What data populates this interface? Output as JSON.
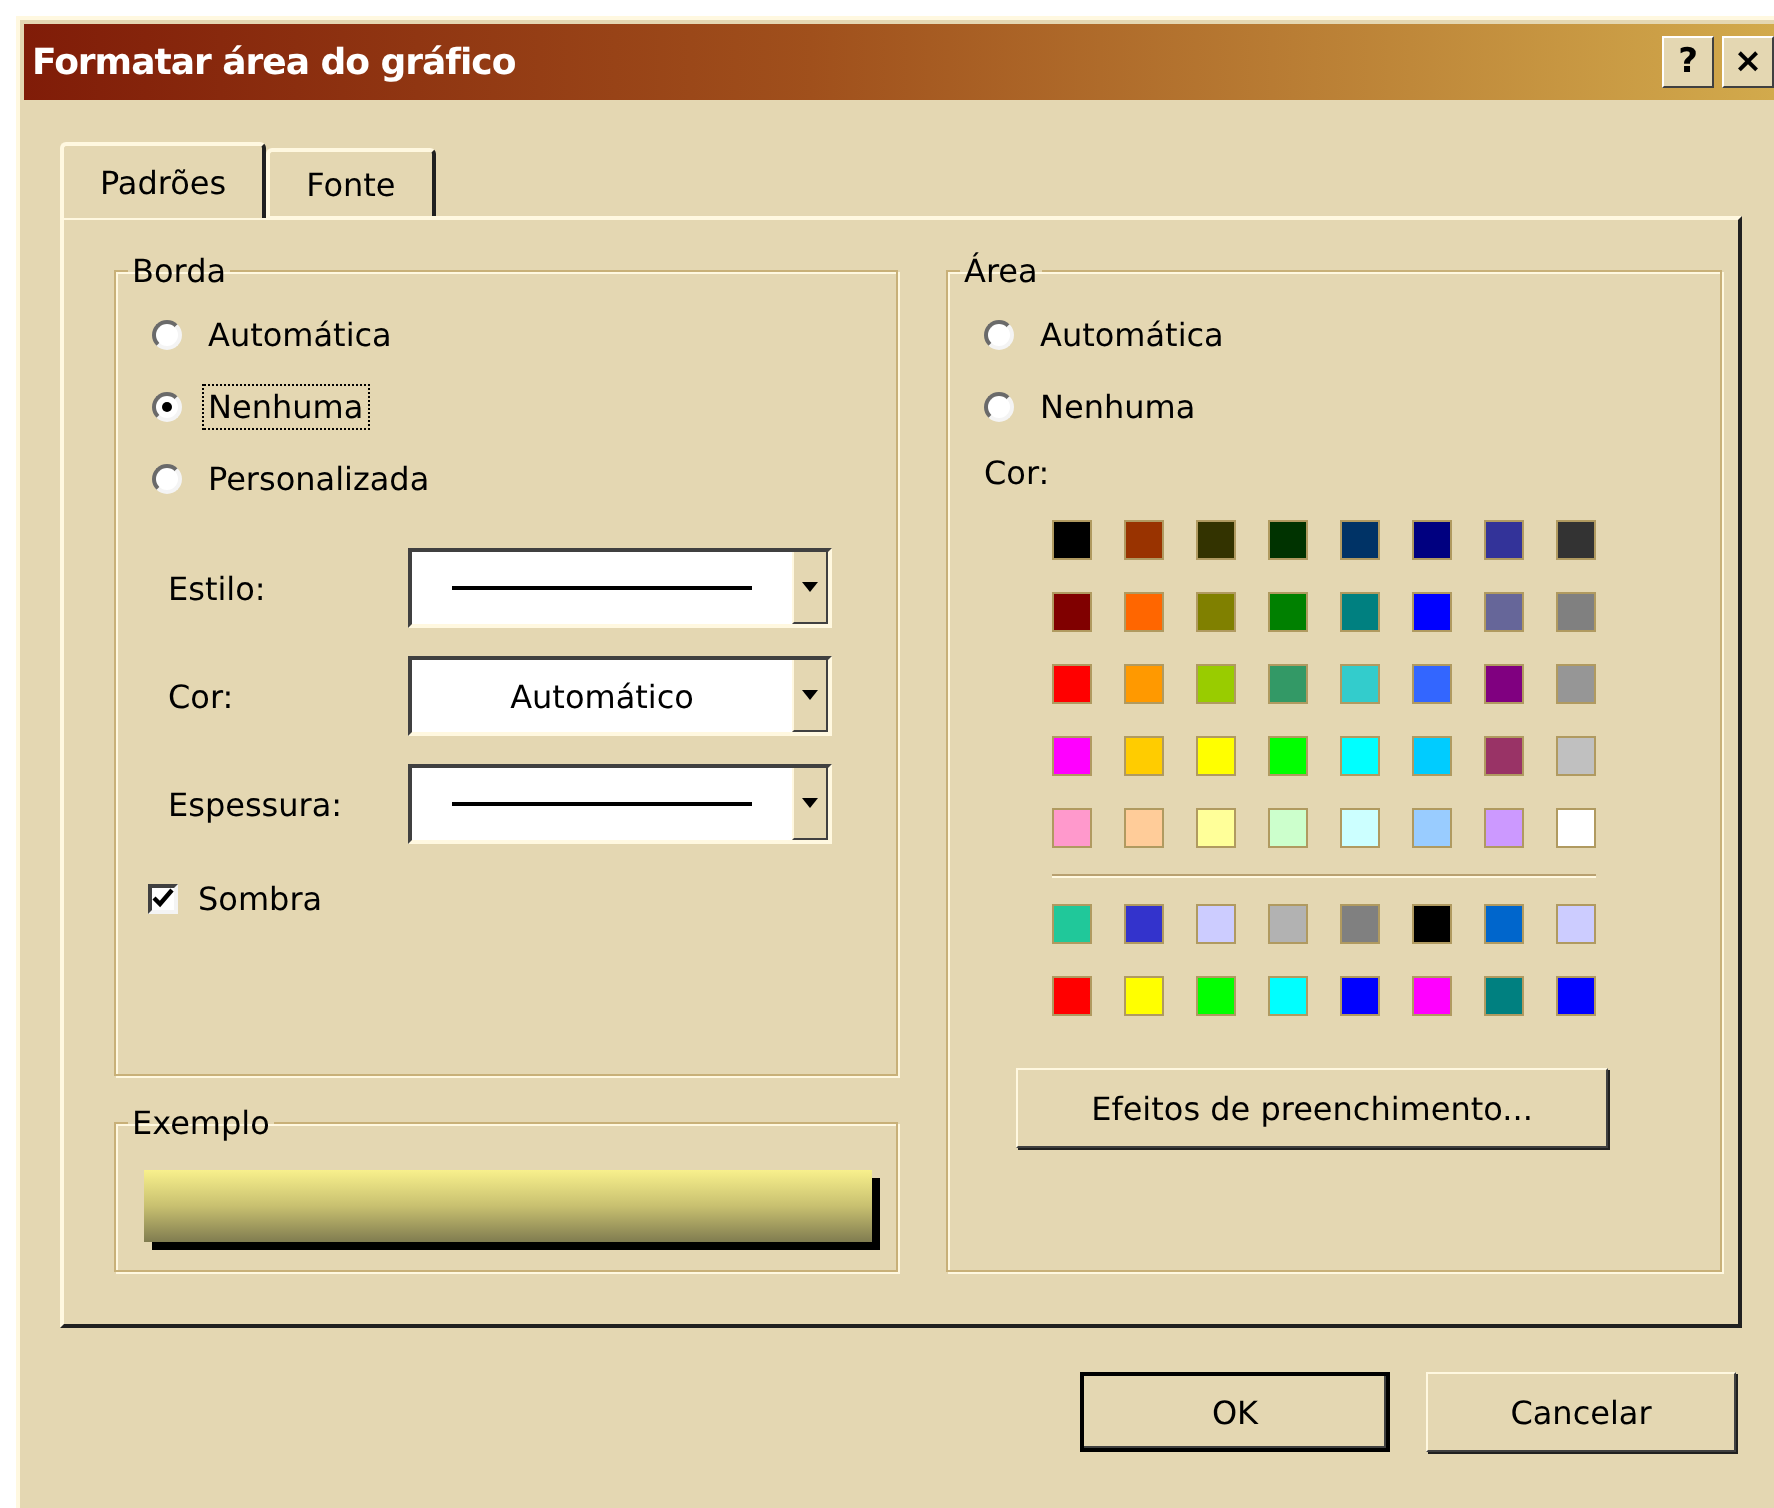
{
  "window": {
    "title": "Formatar área do gráfico",
    "help_button": "?",
    "close_button": "×"
  },
  "tabs": [
    {
      "label": "Padrões",
      "selected": true
    },
    {
      "label": "Fonte",
      "selected": false
    }
  ],
  "border_group": {
    "title": "Borda",
    "options": [
      {
        "label": "Automática",
        "selected": false,
        "focused": false
      },
      {
        "label": "Nenhuma",
        "selected": true,
        "focused": true
      },
      {
        "label": "Personalizada",
        "selected": false,
        "focused": false
      }
    ],
    "fields": [
      {
        "label": "Estilo:",
        "kind": "line"
      },
      {
        "label": "Cor:",
        "kind": "text",
        "value": "Automático"
      },
      {
        "label": "Espessura:",
        "kind": "line"
      }
    ],
    "shadow": {
      "label": "Sombra",
      "checked": true
    }
  },
  "example_group": {
    "title": "Exemplo"
  },
  "area_group": {
    "title": "Área",
    "options": [
      {
        "label": "Automática",
        "selected": false,
        "focused": false
      },
      {
        "label": "Nenhuma",
        "selected": false,
        "focused": false
      }
    ],
    "color_label": "Cor:",
    "standard_colors": [
      [
        {
          "color": "#000000"
        },
        {
          "color": "#993300"
        },
        {
          "color": "#333300"
        },
        {
          "color": "#003300"
        },
        {
          "color": "#003366"
        },
        {
          "color": "#000080"
        },
        {
          "color": "#333399"
        },
        {
          "color": "#333333"
        }
      ],
      [
        {
          "color": "#800000"
        },
        {
          "color": "#ff6600"
        },
        {
          "color": "#808000"
        },
        {
          "color": "#008000"
        },
        {
          "color": "#008080"
        },
        {
          "color": "#0000ff"
        },
        {
          "color": "#666699"
        },
        {
          "color": "#808080"
        }
      ],
      [
        {
          "color": "#ff0000"
        },
        {
          "color": "#ff9900"
        },
        {
          "color": "#99cc00"
        },
        {
          "color": "#339966"
        },
        {
          "color": "#33cccc"
        },
        {
          "color": "#3366ff"
        },
        {
          "color": "#800080"
        },
        {
          "color": "#969696"
        }
      ],
      [
        {
          "color": "#ff00ff"
        },
        {
          "color": "#ffcc00"
        },
        {
          "color": "#ffff00"
        },
        {
          "color": "#00ff00"
        },
        {
          "color": "#00ffff"
        },
        {
          "color": "#00ccff"
        },
        {
          "color": "#993366"
        },
        {
          "color": "#c0c0c0"
        }
      ],
      [
        {
          "color": "#ff99cc"
        },
        {
          "color": "#ffcc99"
        },
        {
          "color": "#ffff99"
        },
        {
          "color": "#ccffcc"
        },
        {
          "color": "#ccffff"
        },
        {
          "color": "#99ccff"
        },
        {
          "color": "#cc99ff"
        },
        {
          "color": "#ffffff"
        }
      ]
    ],
    "chart_colors": [
      [
        {
          "color": "#20c89a"
        },
        {
          "color": "#3333cc"
        },
        {
          "color": "#ccccff"
        },
        {
          "color": "#b2b2b2"
        },
        {
          "color": "#808080"
        },
        {
          "color": "#000000"
        },
        {
          "color": "#0066cc"
        },
        {
          "color": "#ccccff"
        }
      ],
      [
        {
          "color": "#ff0000"
        },
        {
          "color": "#ffff00"
        },
        {
          "color": "#00ff00"
        },
        {
          "color": "#00ffff"
        },
        {
          "color": "#0000ff"
        },
        {
          "color": "#ff00ff"
        },
        {
          "color": "#008080"
        },
        {
          "color": "#0000ff"
        }
      ]
    ],
    "effects_button": "Efeitos de preenchimento..."
  },
  "buttons": [
    {
      "label": "OK",
      "default": true
    },
    {
      "label": "Cancelar",
      "default": false
    }
  ]
}
